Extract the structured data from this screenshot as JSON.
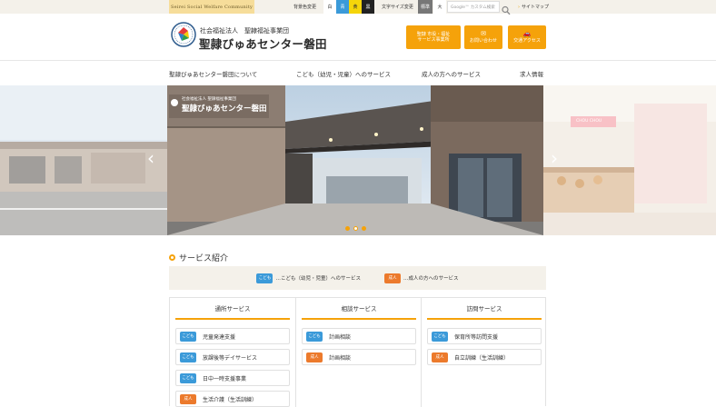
{
  "topbar": {
    "brand_tag": "Seirei Social Welfare Community",
    "bg_color_label": "背景色変更",
    "swatches": [
      {
        "label": "白",
        "bg": "#ffffff",
        "fg": "#333333"
      },
      {
        "label": "青",
        "bg": "#3b9ad9",
        "fg": "#ffffff"
      },
      {
        "label": "黄",
        "bg": "#f5d50a",
        "fg": "#333333"
      },
      {
        "label": "黒",
        "bg": "#222222",
        "fg": "#ffffff"
      }
    ],
    "font_size_label": "文字サイズ変更",
    "font_standard": "標準",
    "font_large": "大",
    "search_placeholder": "Google™ カスタム検索",
    "sitemap_arrow": "›",
    "sitemap_label": "サイトマップ"
  },
  "header": {
    "org_sub": "社会福祉法人　聖隷福祉事業団",
    "org_name": "聖隷びゅあセンター磐田",
    "buttons": [
      {
        "icon": "",
        "line1": "聖隷 市役・福祉",
        "line2": "サービス事業所"
      },
      {
        "icon": "✉",
        "line1": "お問い合わせ",
        "line2": ""
      },
      {
        "icon": "🚗",
        "line1": "交通アクセス",
        "line2": ""
      }
    ]
  },
  "nav": {
    "items": [
      "聖隷びゅあセンター磐田について",
      "こども（幼児・児童）へのサービス",
      "成人の方へのサービス",
      "求人情報"
    ]
  },
  "hero": {
    "sign_sub": "社会福祉法人 聖隷福祉事業団",
    "sign_name": "聖隷びゅあセンター磐田",
    "shop_sign": "CHOU CHOU",
    "prev": "‹",
    "next": "›",
    "slide_count": 3,
    "active_slide": 2
  },
  "services": {
    "title": "サービス紹介",
    "legend": {
      "kodomo_tag": "こども",
      "kodomo_text": "…こども（幼児・児童）へのサービス",
      "seijin_tag": "成人",
      "seijin_text": "…成人の方へのサービス"
    },
    "columns": [
      {
        "heading": "通所サービス",
        "items": [
          {
            "tag": "こども",
            "type": "kodomo",
            "label": "児童発達支援"
          },
          {
            "tag": "こども",
            "type": "kodomo",
            "label": "放課後等デイサービス"
          },
          {
            "tag": "こども",
            "type": "kodomo",
            "label": "日中一時支援事業"
          },
          {
            "tag": "成人",
            "type": "seijin",
            "label": "生活介護（生活訓練）"
          }
        ]
      },
      {
        "heading": "相談サービス",
        "items": [
          {
            "tag": "こども",
            "type": "kodomo",
            "label": "計画相談"
          },
          {
            "tag": "成人",
            "type": "seijin",
            "label": "計画相談"
          }
        ]
      },
      {
        "heading": "訪問サービス",
        "items": [
          {
            "tag": "こども",
            "type": "kodomo",
            "label": "保育所等訪問支援"
          },
          {
            "tag": "成人",
            "type": "seijin",
            "label": "自立訓練（生活訓練）"
          }
        ]
      }
    ]
  }
}
